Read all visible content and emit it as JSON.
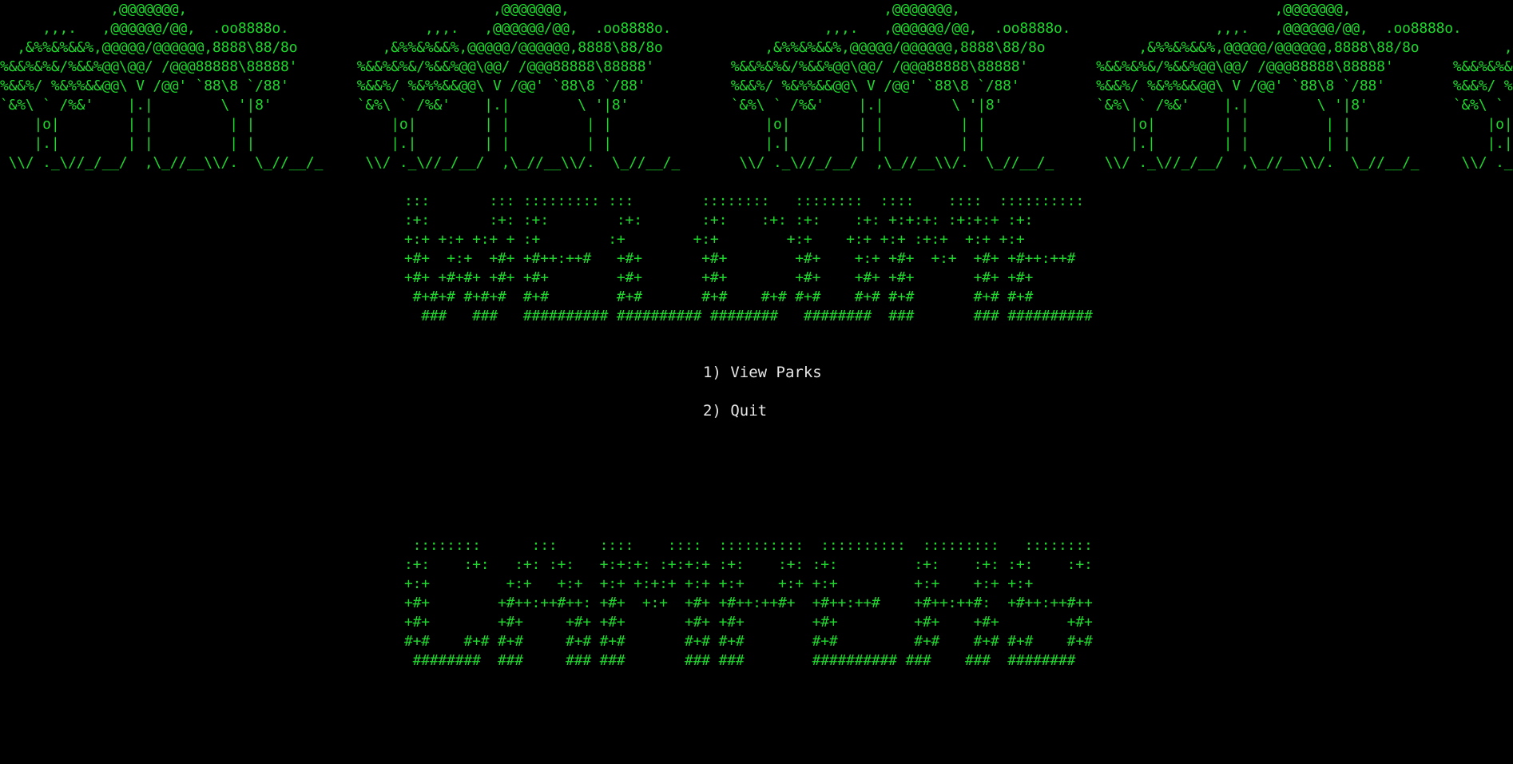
{
  "colors": {
    "background": "#000000",
    "art": "#1ed82d",
    "menu_text": "#e6e6e6"
  },
  "banner_trees": {
    "lines": [
      "             ,@@@@@@@,                                    ,@@@@@@@,                                     ,@@@@@@@,                                     ,@@@@@@@,                                    ,@@@@",
      "     ,,,.   ,@@@@@@/@@,  .oo8888o.                ,,,.   ,@@@@@@/@@,  .oo8888o.                  ,,,.   ,@@@@@@/@@,  .oo8888o.                 ,,,.   ,@@@@@@/@@,  .oo8888o.                ,,,.   ,@@@@",
      "  ,&%%&%&&%,@@@@@/@@@@@@,8888\\88/8o          ,&%%&%&&%,@@@@@/@@@@@@,8888\\88/8o            ,&%%&%&&%,@@@@@/@@@@@@,8888\\88/8o           ,&%%&%&&%,@@@@@/@@@@@@,8888\\88/8o          ,&%%&%&&%,@@@@",
      "%&&%&%&/%&&%@@\\@@/ /@@@88888\\88888'       %&&%&%&/%&&%@@\\@@/ /@@@88888\\88888'         %&&%&%&/%&&%@@\\@@/ /@@@88888\\88888'        %&&%&%&/%&&%@@\\@@/ /@@@88888\\88888'       %&&%&%&/%&&%@@\\@@",
      "%&&%/ %&%%&&@@\\ V /@@' `88\\8 `/88'        %&&%/ %&%%&&@@\\ V /@@' `88\\8 `/88'          %&&%/ %&%%&&@@\\ V /@@' `88\\8 `/88'         %&&%/ %&%%&&@@\\ V /@@' `88\\8 `/88'        %&&%/ %&%%&&@@\\ ",
      "`&%\\ ` /%&'    |.|        \\ '|8'          `&%\\ ` /%&'    |.|        \\ '|8'            `&%\\ ` /%&'    |.|        \\ '|8'           `&%\\ ` /%&'    |.|        \\ '|8'          `&%\\ ` /%&'    |",
      "    |o|        | |         | |                |o|        | |         | |                  |o|        | |         | |                 |o|        | |         | |                |o|        |",
      "    |.|        | |         | |                |.|        | |         | |                  |.|        | |         | |                 |.|        | |         | |                |.|        |",
      " \\\\/ ._\\//_/__/  ,\\_//__\\\\/.  \\_//__/_     \\\\/ ._\\//_/__/  ,\\_//__\\\\/.  \\_//__/_       \\\\/ ._\\//_/__/  ,\\_//__\\\\/.  \\_//__/_      \\\\/ ._\\//_/__/  ,\\_//__\\\\/.  \\_//__/_     \\\\/ ._\\//_/__/"
    ]
  },
  "banner_welcome": {
    "lines": [
      ":::       ::: ::::::::: :::        ::::::::   ::::::::  ::::    ::::  ::::::::::",
      ":+:       :+: :+:        :+:       :+:    :+: :+:    :+: +:+:+: :+:+:+ :+:",
      "+:+ +:+ +:+ + :+        :+        +:+        +:+    +:+ +:+ :+:+  +:+ +:+",
      "+#+  +:+  +#+ +#++:++#   +#+       +#+        +#+    +:+ +#+  +:+  +#+ +#++:++#",
      "+#+ +#+#+ +#+ +#+        +#+       +#+        +#+    +#+ +#+       +#+ +#+",
      " #+#+# #+#+#  #+#        #+#       #+#    #+# #+#    #+# #+#       #+# #+#",
      "  ###   ###   ########## ########## ########   ########  ###       ### ##########"
    ]
  },
  "menu": {
    "items": [
      {
        "label": "1) View Parks"
      },
      {
        "label": "2) Quit"
      }
    ]
  },
  "banner_arcade": {
    "lines": [
      " ::::::::      :::     ::::    ::::  ::::::::::  ::::::::::  :::::::::   ::::::::",
      ":+:    :+:   :+: :+:   +:+:+: :+:+:+ :+:    :+: :+:         :+:    :+: :+:    :+:",
      "+:+         +:+   +:+  +:+ +:+:+ +:+ +:+    +:+ +:+         +:+    +:+ +:+",
      "+#+        +#++:++#++: +#+  +:+  +#+ +#++:++#+  +#++:++#    +#++:++#:  +#++:++#++",
      "+#+        +#+     +#+ +#+       +#+ +#+        +#+         +#+    +#+        +#+",
      "#+#    #+# #+#     #+# #+#       #+# #+#        #+#         #+#    #+# #+#    #+#",
      " ########  ###     ### ###       ### ###        ########## ###    ###  ########"
    ]
  }
}
